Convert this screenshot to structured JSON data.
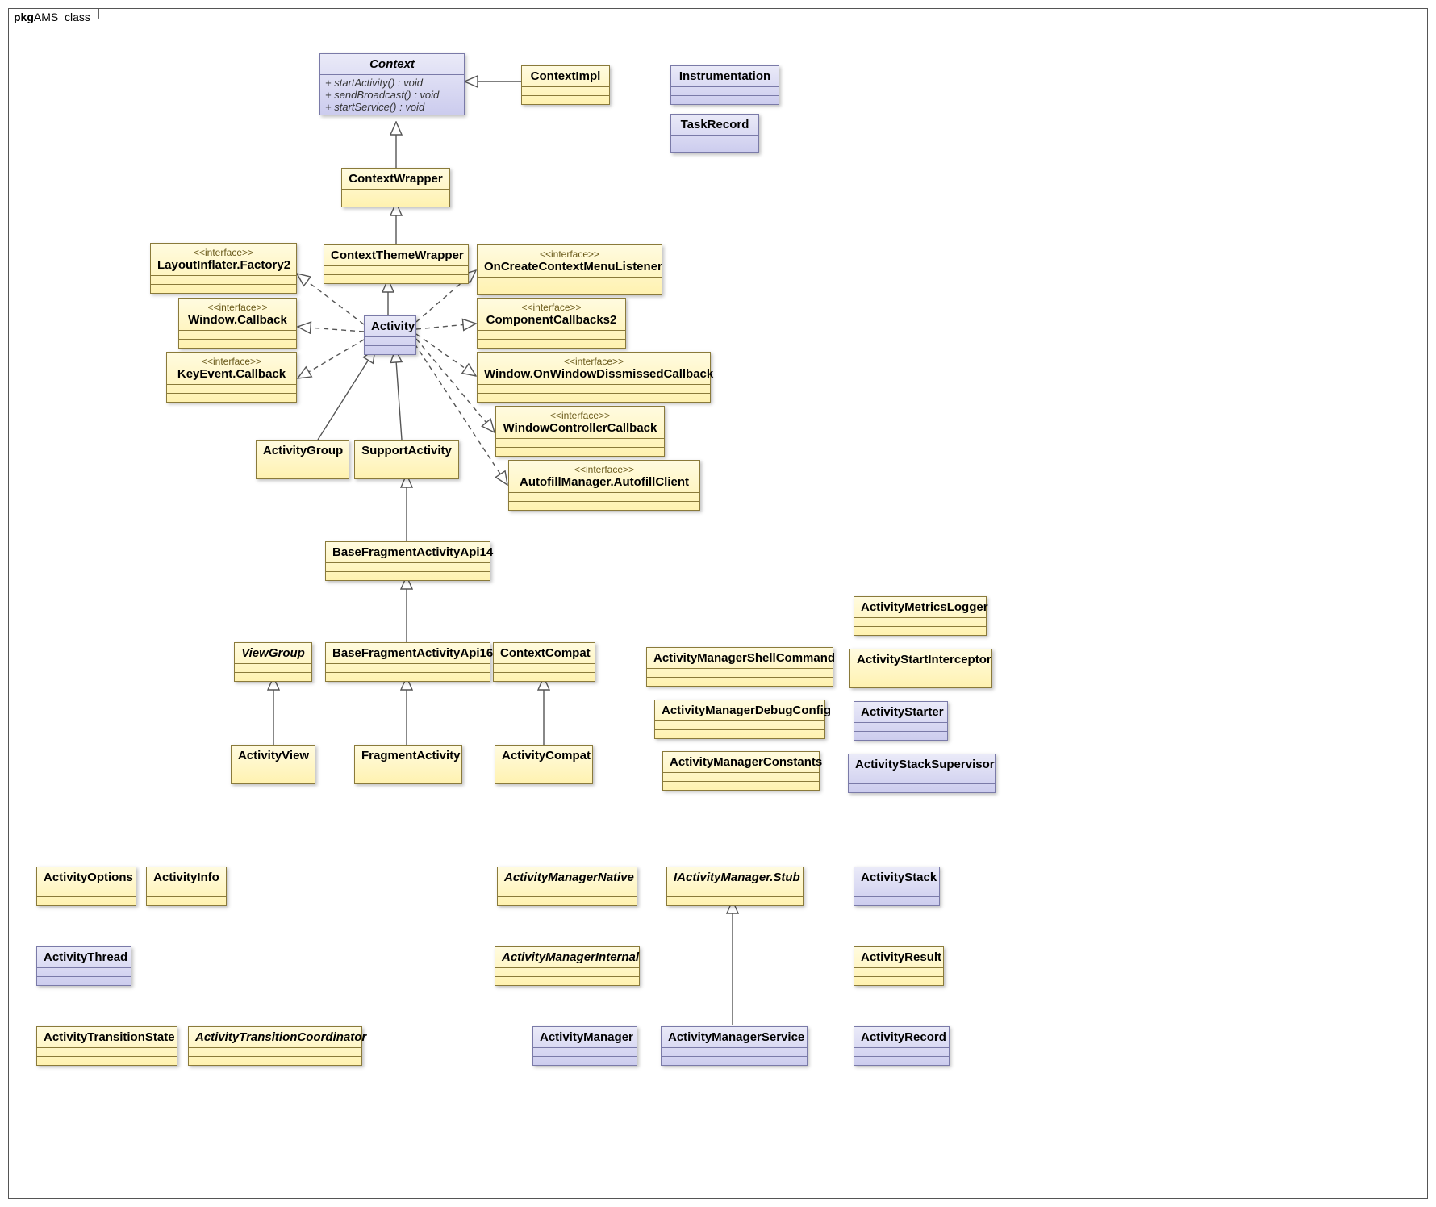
{
  "package": {
    "prefix": "pkg",
    "name": "AMS_class"
  },
  "classes": {
    "Context": {
      "name": "Context",
      "abstract": true,
      "blue": true,
      "methods": [
        "+ startActivity() : void",
        "+ sendBroadcast() : void",
        "+ startService() : void"
      ]
    },
    "ContextImpl": {
      "name": "ContextImpl"
    },
    "Instrumentation": {
      "name": "Instrumentation",
      "blue": true
    },
    "TaskRecord": {
      "name": "TaskRecord",
      "blue": true
    },
    "ContextWrapper": {
      "name": "ContextWrapper"
    },
    "ContextThemeWrapper": {
      "name": "ContextThemeWrapper"
    },
    "Activity": {
      "name": "Activity",
      "blue": true
    },
    "LayoutInflaterFactory2": {
      "name": "LayoutInflater.Factory2",
      "stereo": "<<interface>>"
    },
    "WindowCallback": {
      "name": "Window.Callback",
      "stereo": "<<interface>>"
    },
    "KeyEventCallback": {
      "name": "KeyEvent.Callback",
      "stereo": "<<interface>>"
    },
    "OnCreateContextMenuListener": {
      "name": "OnCreateContextMenuListener",
      "stereo": "<<interface>>"
    },
    "ComponentCallbacks2": {
      "name": "ComponentCallbacks2",
      "stereo": "<<interface>>"
    },
    "WindowOnWindowDismissedCallback": {
      "name": "Window.OnWindowDissmissedCallback",
      "stereo": "<<interface>>"
    },
    "WindowControllerCallback": {
      "name": "WindowControllerCallback",
      "stereo": "<<interface>>"
    },
    "AutofillManagerAutofillClient": {
      "name": "AutofillManager.AutofillClient",
      "stereo": "<<interface>>"
    },
    "ActivityGroup": {
      "name": "ActivityGroup"
    },
    "SupportActivity": {
      "name": "SupportActivity"
    },
    "BaseFragmentActivityApi14": {
      "name": "BaseFragmentActivityApi14"
    },
    "BaseFragmentActivityApi16": {
      "name": "BaseFragmentActivityApi16"
    },
    "FragmentActivity": {
      "name": "FragmentActivity"
    },
    "ViewGroup": {
      "name": "ViewGroup",
      "abstract": true
    },
    "ActivityView": {
      "name": "ActivityView"
    },
    "ContextCompat": {
      "name": "ContextCompat"
    },
    "ActivityCompat": {
      "name": "ActivityCompat"
    },
    "ActivityManagerShellCommand": {
      "name": "ActivityManagerShellCommand"
    },
    "ActivityManagerDebugConfig": {
      "name": "ActivityManagerDebugConfig"
    },
    "ActivityManagerConstants": {
      "name": "ActivityManagerConstants"
    },
    "ActivityMetricsLogger": {
      "name": "ActivityMetricsLogger"
    },
    "ActivityStartInterceptor": {
      "name": "ActivityStartInterceptor"
    },
    "ActivityStarter": {
      "name": "ActivityStarter",
      "blue": true
    },
    "ActivityStackSupervisor": {
      "name": "ActivityStackSupervisor",
      "blue": true
    },
    "ActivityStack": {
      "name": "ActivityStack",
      "blue": true
    },
    "ActivityResult": {
      "name": "ActivityResult"
    },
    "ActivityRecord": {
      "name": "ActivityRecord",
      "blue": true
    },
    "ActivityOptions": {
      "name": "ActivityOptions"
    },
    "ActivityInfo": {
      "name": "ActivityInfo"
    },
    "ActivityThread": {
      "name": "ActivityThread",
      "blue": true
    },
    "ActivityTransitionState": {
      "name": "ActivityTransitionState"
    },
    "ActivityTransitionCoordinator": {
      "name": "ActivityTransitionCoordinator",
      "abstract": true
    },
    "ActivityManagerNative": {
      "name": "ActivityManagerNative",
      "abstract": true
    },
    "ActivityManagerInternal": {
      "name": "ActivityManagerInternal",
      "abstract": true
    },
    "ActivityManager": {
      "name": "ActivityManager",
      "blue": true
    },
    "IActivityManagerStub": {
      "name": "IActivityManager.Stub",
      "abstract": true
    },
    "ActivityManagerService": {
      "name": "ActivityManagerService",
      "blue": true
    }
  }
}
